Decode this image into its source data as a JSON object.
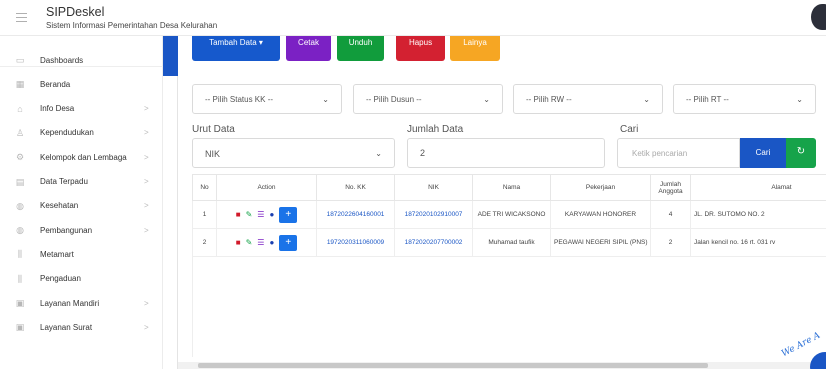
{
  "header": {
    "app_title": "SIPDeskel",
    "app_subtitle": "Sistem Informasi Pemerintahan Desa Kelurahan"
  },
  "sidebar": {
    "items": [
      {
        "label": "Dashboards",
        "icon": "monitor-icon",
        "chevron": ""
      },
      {
        "label": "Beranda",
        "icon": "grid-icon",
        "chevron": ""
      },
      {
        "label": "Info Desa",
        "icon": "building-icon",
        "chevron": ">"
      },
      {
        "label": "Kependudukan",
        "icon": "user-icon",
        "chevron": ">"
      },
      {
        "label": "Kelompok dan Lembaga",
        "icon": "group-icon",
        "chevron": ">"
      },
      {
        "label": "Data Terpadu",
        "icon": "table-icon",
        "chevron": ">"
      },
      {
        "label": "Kesehatan",
        "icon": "globe-icon",
        "chevron": ">"
      },
      {
        "label": "Pembangunan",
        "icon": "globe-icon",
        "chevron": ">"
      },
      {
        "label": "Metamart",
        "icon": "bar-icon",
        "chevron": ""
      },
      {
        "label": "Pengaduan",
        "icon": "bar-icon",
        "chevron": ""
      },
      {
        "label": "Layanan Mandiri",
        "icon": "doc-icon",
        "chevron": ">"
      },
      {
        "label": "Layanan Surat",
        "icon": "doc-icon",
        "chevron": ">"
      }
    ]
  },
  "toolbar": {
    "tambah_label": "Tambah Data ▾",
    "cetak_label": "Cetak",
    "unduh_label": "Unduh",
    "hapus_label": "Hapus",
    "lainya_label": "Lainya"
  },
  "filters": {
    "status_kk": "-- Pilih Status KK --",
    "dusun": "-- Pilih Dusun --",
    "rw": "-- Pilih RW --",
    "rt": "-- Pilih RT --",
    "chevron": "⌄"
  },
  "controls": {
    "urut_label": "Urut Data",
    "urut_value": "NIK",
    "jumlah_label": "Jumlah Data",
    "jumlah_value": "2",
    "cari_label": "Cari",
    "search_placeholder": "Ketik pencarian",
    "cari_button": "Cari",
    "refresh_icon": "↻"
  },
  "table": {
    "headers": [
      "No",
      "Action",
      "No. KK",
      "NIK",
      "Nama",
      "Pekerjaan",
      "Jumlah Anggota",
      "Alamat"
    ],
    "rows": [
      {
        "no": "1",
        "kk": "1872022604160001",
        "nik": "1872020102910007",
        "nama": "ADE TRI WICAKSONO",
        "pekerjaan": "KARYAWAN HONORER",
        "jumlah": "4",
        "alamat": "JL. DR. SUTOMO NO. 2"
      },
      {
        "no": "2",
        "kk": "1972020311060009",
        "nik": "1872020207700002",
        "nama": "Muhamad taufik",
        "pekerjaan": "PEGAWAI NEGERI SIPIL (PNS)",
        "jumlah": "2",
        "alamat": "Jalan kencil no. 16 rt. 031 rv"
      }
    ]
  },
  "watermark": {
    "text": "We Are A"
  }
}
